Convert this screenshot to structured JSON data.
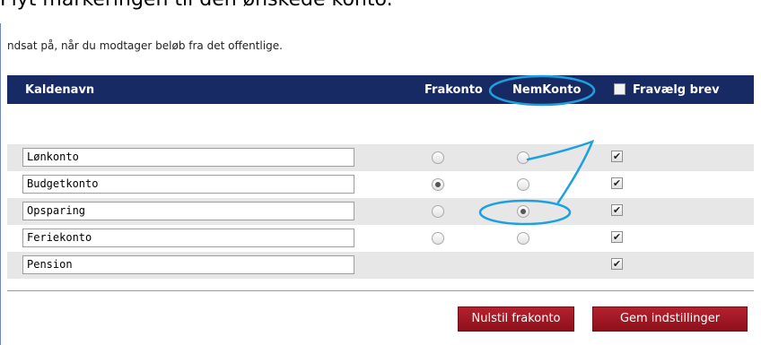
{
  "heading": "Flyt markeringen til den ønskede konto.",
  "intro_text": "ndsat på, når du modtager beløb fra det offentlige.",
  "table": {
    "headers": {
      "name": "Kaldenavn",
      "frakonto": "Frakonto",
      "nemkonto": "NemKonto",
      "fravaelg": "Fravælg brev"
    },
    "rows": [
      {
        "name": "Lønkonto",
        "frakonto": false,
        "nemkonto": false,
        "fravaelg": true
      },
      {
        "name": "Budgetkonto",
        "frakonto": true,
        "nemkonto": false,
        "fravaelg": true
      },
      {
        "name": "Opsparing",
        "frakonto": false,
        "nemkonto": true,
        "fravaelg": true
      },
      {
        "name": "Feriekonto",
        "frakonto": false,
        "nemkonto": false,
        "fravaelg": true
      },
      {
        "name": "Pension",
        "fravaelg": true
      }
    ]
  },
  "buttons": {
    "reset": "Nulstil frakonto",
    "save": "Gem indstillinger"
  },
  "colors": {
    "header_bg": "#172a63",
    "button_bg": "#a31a26",
    "annotation": "#1ea0e0",
    "row_gray": "#e7e7e7"
  }
}
